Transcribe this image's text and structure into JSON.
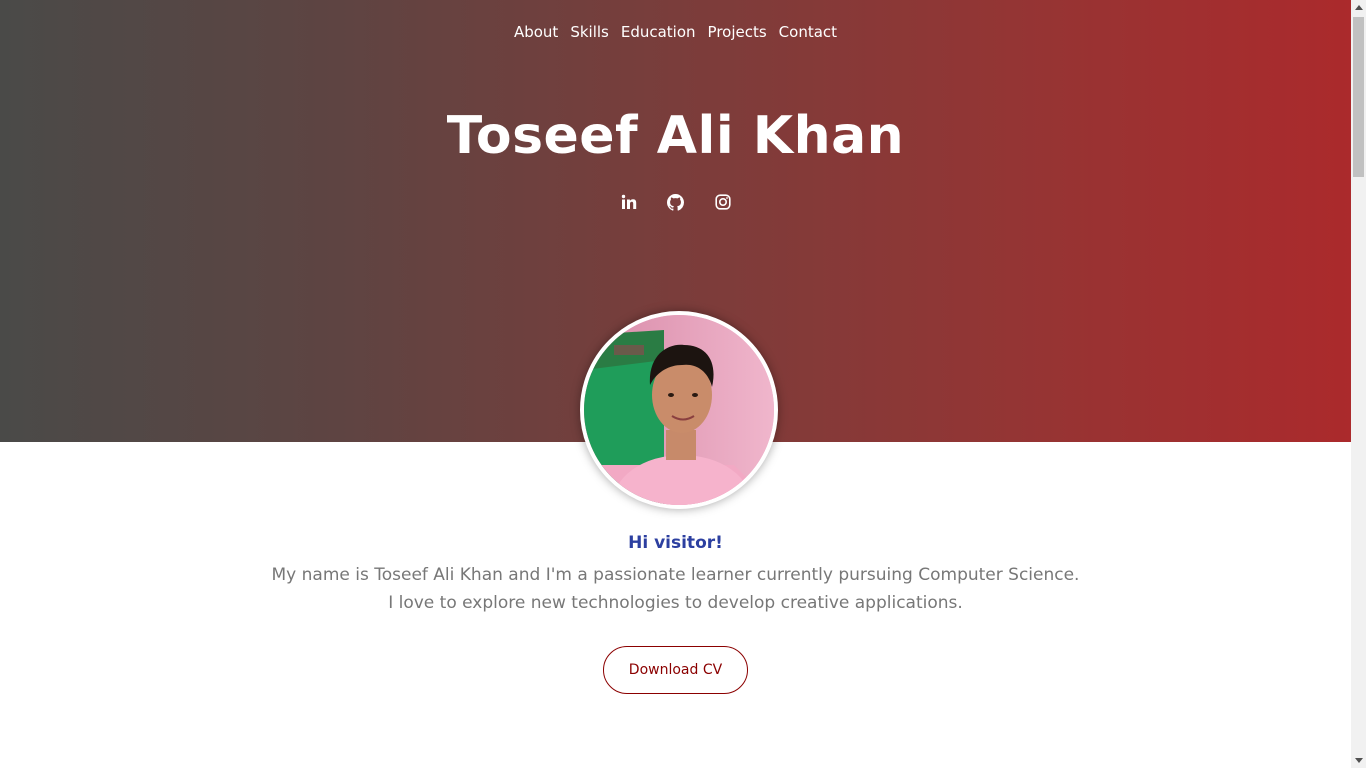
{
  "nav": {
    "items": [
      {
        "label": "About"
      },
      {
        "label": "Skills"
      },
      {
        "label": "Education"
      },
      {
        "label": "Projects"
      },
      {
        "label": "Contact"
      }
    ]
  },
  "hero": {
    "name": "Toseef Ali Khan",
    "social_icons": [
      "linkedin-icon",
      "github-icon",
      "instagram-icon"
    ]
  },
  "about": {
    "greeting": "Hi visitor!",
    "line1": "My name is Toseef Ali Khan and I'm a passionate learner currently pursuing Computer Science.",
    "line2": "I love to explore new technologies to develop creative applications."
  },
  "cv_button": {
    "label": "Download CV"
  },
  "colors": {
    "gradient_start": "#4a4a48",
    "gradient_end": "#ab2a2c",
    "greeting": "#2c3fa0",
    "button_accent": "#8b0000",
    "body_text": "#777777"
  }
}
